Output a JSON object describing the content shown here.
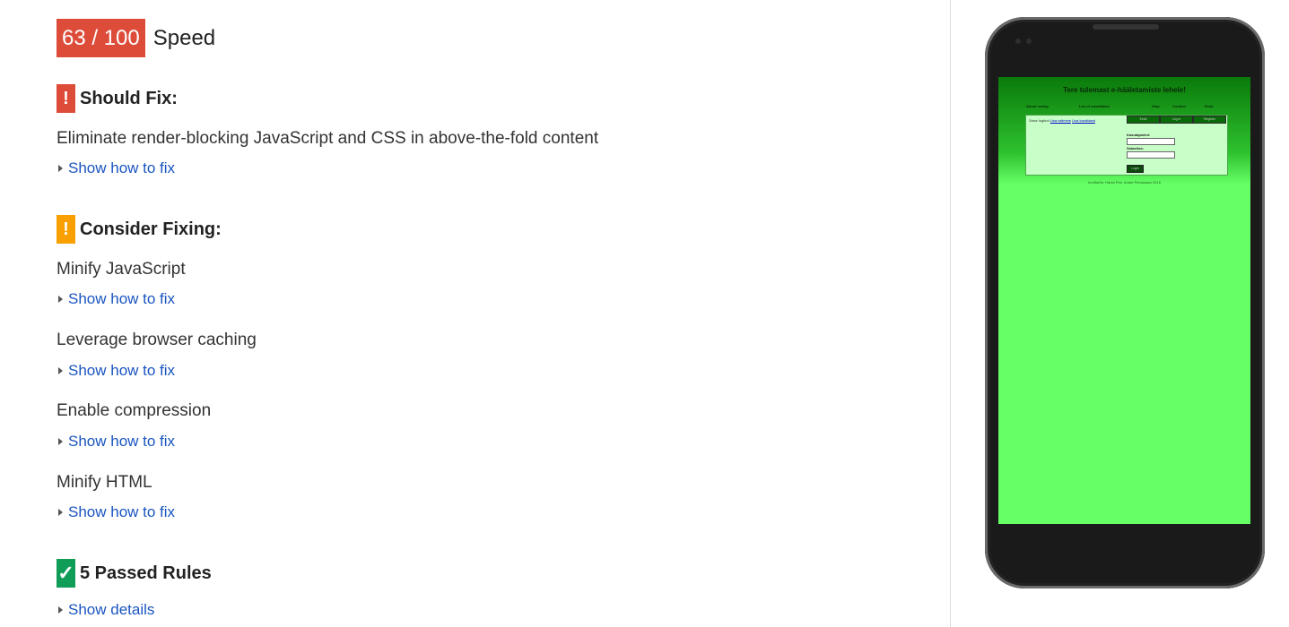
{
  "score": {
    "value": "63 / 100",
    "label": "Speed"
  },
  "should_fix": {
    "title": "Should Fix:",
    "rules": [
      {
        "title": "Eliminate render-blocking JavaScript and CSS in above-the-fold content",
        "link": "Show how to fix"
      }
    ]
  },
  "consider_fixing": {
    "title": "Consider Fixing:",
    "rules": [
      {
        "title": "Minify JavaScript",
        "link": "Show how to fix"
      },
      {
        "title": "Leverage browser caching",
        "link": "Show how to fix"
      },
      {
        "title": "Enable compression",
        "link": "Show how to fix"
      },
      {
        "title": "Minify HTML",
        "link": "Show how to fix"
      }
    ]
  },
  "passed": {
    "title": "5 Passed Rules",
    "link": "Show details"
  },
  "icons": {
    "should_fix": "exclamation-icon",
    "consider": "exclamation-icon",
    "passed": "checkmark-icon"
  },
  "colors": {
    "score_badge": "#dd4b39",
    "should_fix": "#dd4b39",
    "consider": "#f9a000",
    "passed": "#0f9d58",
    "link": "#1a55c0"
  },
  "preview": {
    "site_title": "Tere tulemast e-hääletamiste lehele!",
    "nav": [
      "About voting",
      "List of candidates",
      "Help",
      "Contact",
      "Eesti"
    ],
    "panel_text": "Sisse logitud",
    "panel_links": [
      "Lisa valimine",
      "Lisa kandidaat"
    ],
    "tabs": [
      "Eesti",
      "Log in",
      "Register"
    ],
    "username_label": "Kasutajanimi:",
    "password_label": "Salasõna:",
    "submit_label": "Login",
    "footer": "Ira Martin, Harko Pirk, Andre Peedosaar 2016"
  }
}
